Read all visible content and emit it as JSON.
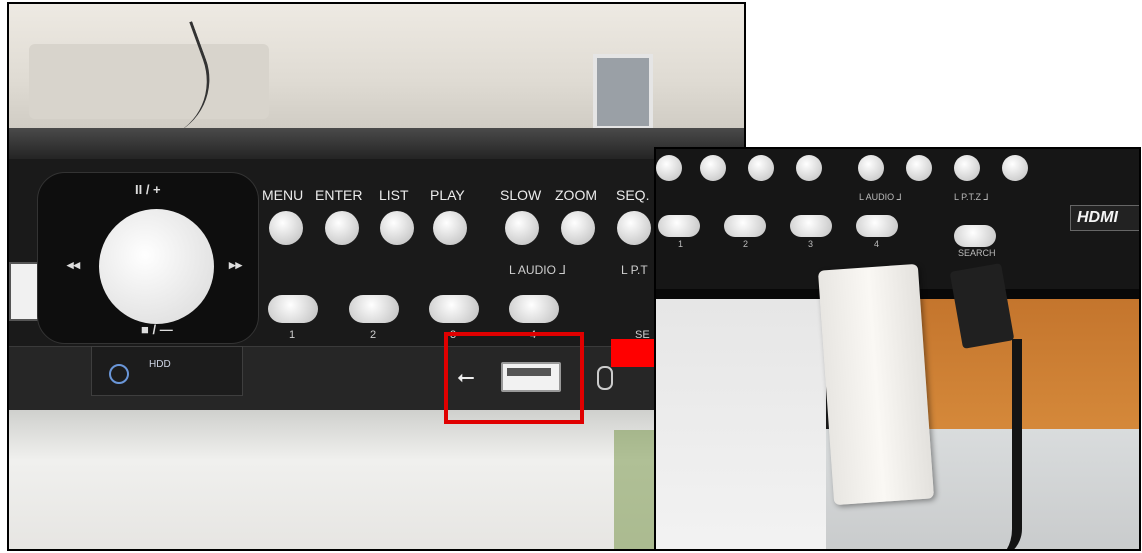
{
  "left_photo": {
    "nav": {
      "top": "II / +",
      "bottom": "■ / —",
      "left": "◂◂",
      "right": "▸▸"
    },
    "buttons": [
      {
        "label": "MENU"
      },
      {
        "label": "ENTER"
      },
      {
        "label": "LIST"
      },
      {
        "label": "PLAY"
      },
      {
        "label": "SLOW"
      },
      {
        "label": "ZOOM"
      },
      {
        "label": "SEQ."
      }
    ],
    "pills": [
      "1",
      "2",
      "3",
      "4"
    ],
    "audio_label": "L AUDIO ⅃",
    "ptz_label": "L P.T",
    "search_partial": "SE",
    "hdd_label": "HDD"
  },
  "right_photo": {
    "audio_label": "L AUDIO ⅃",
    "ptz_label": "L P.T.Z ⅃",
    "pills": [
      "1",
      "2",
      "3",
      "4"
    ],
    "search_label": "SEARCH",
    "hdmi_label": "HDMI"
  },
  "colors": {
    "highlight": "#e00000",
    "arrow": "#ff0000"
  }
}
